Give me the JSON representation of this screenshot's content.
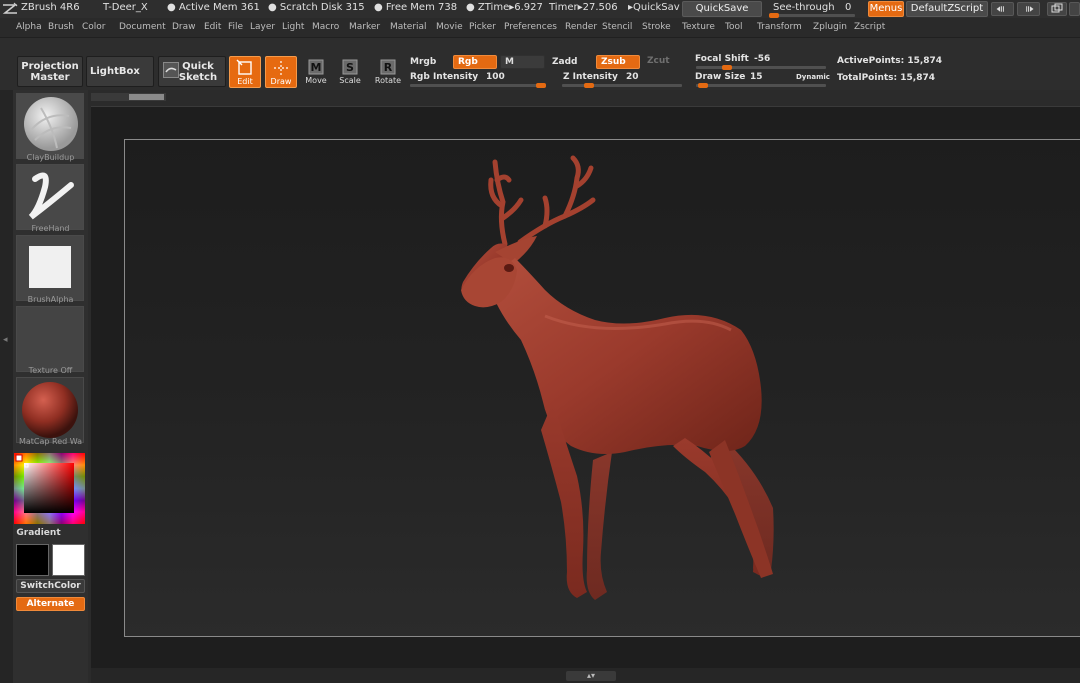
{
  "titlebar": {
    "app": "ZBrush 4R6",
    "document": "T-Deer_X",
    "active_mem": "● Active Mem 361",
    "scratch_disk": "● Scratch Disk 315",
    "free_mem": "● Free Mem 738",
    "ztime": "● ZTime▸6.927",
    "timer": "Timer▸27.506",
    "quicksave_status": "▸QuickSav",
    "quicksave_button": "QuickSave",
    "see_through_label": "See-through",
    "see_through_value": "0",
    "see_through_fraction": 0.0,
    "menus_button": "Menus",
    "zscript_button": "DefaultZScript"
  },
  "menubar": {
    "items": [
      "Alpha",
      "Brush",
      "Color",
      "Document",
      "Draw",
      "Edit",
      "File",
      "Layer",
      "Light",
      "Macro",
      "Marker",
      "Material",
      "Movie",
      "Picker",
      "Preferences",
      "Render",
      "Stencil",
      "Stroke",
      "Texture",
      "Tool",
      "Transform",
      "Zplugin",
      "Zscript"
    ]
  },
  "toolbar": {
    "projection_master": [
      "Projection",
      "Master"
    ],
    "lightbox": "LightBox",
    "quick_sketch": [
      "Quick",
      "Sketch"
    ],
    "edit": "Edit",
    "draw": "Draw",
    "move": "Move",
    "scale": "Scale",
    "rotate": "Rotate",
    "mrgb": "Mrgb",
    "rgb": "Rgb",
    "m": "M",
    "rgb_intensity_label": "Rgb Intensity",
    "rgb_intensity_value": "100",
    "rgb_intensity_fraction": 1.0,
    "zadd": "Zadd",
    "zsub": "Zsub",
    "zcut": "Zcut",
    "z_intensity_label": "Z Intensity",
    "z_intensity_value": "20",
    "z_intensity_fraction": 0.2,
    "focal_shift_label": "Focal Shift",
    "focal_shift_value": "-56",
    "focal_shift_fraction": 0.22,
    "draw_size_label": "Draw Size",
    "draw_size_value": "15",
    "draw_size_fraction": 0.015,
    "dynamic": "Dynamic",
    "active_points": "ActivePoints: 15,874",
    "total_points": "TotalPoints: 15,874"
  },
  "leftshelf": {
    "brush": "ClayBuildup",
    "stroke": "FreeHand",
    "alpha": "BrushAlpha",
    "texture": "Texture Off",
    "material": "MatCap Red Wa",
    "gradient": "Gradient",
    "switch_color": "SwitchColor",
    "alternate": "Alternate"
  },
  "colors": {
    "accent": "#e46a12",
    "model": "#9e3b2e",
    "main_color": "#000000",
    "secondary_color": "#ffffff"
  }
}
